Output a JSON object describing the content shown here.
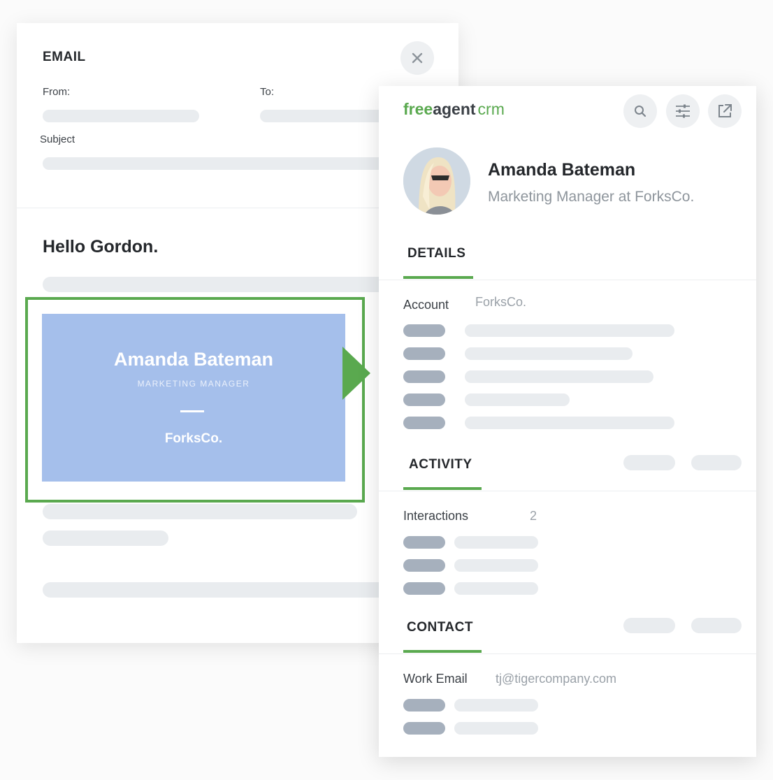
{
  "email": {
    "title": "EMAIL",
    "from_label": "From:",
    "to_label": "To:",
    "subject_label": "Subject",
    "greeting": "Hello Gordon."
  },
  "business_card": {
    "name": "Amanda Bateman",
    "role": "MARKETING MANAGER",
    "company": "ForksCo."
  },
  "crm": {
    "logo": {
      "free": "free",
      "agent": "agent",
      "crm": "crm"
    },
    "toolbar": {
      "icons": [
        "search-icon",
        "sliders-icon",
        "external-link-icon"
      ]
    },
    "contact": {
      "name": "Amanda Bateman",
      "title": "Marketing Manager at ForksCo."
    },
    "details": {
      "heading": "DETAILS",
      "account_label": "Account",
      "account_value": "ForksCo."
    },
    "activity": {
      "heading": "ACTIVITY",
      "interactions_label": "Interactions",
      "interactions_count": "2"
    },
    "contact_section": {
      "heading": "CONTACT",
      "work_email_label": "Work Email",
      "work_email_value": "tj@tigercompany.com"
    }
  },
  "colors": {
    "accent_green": "#5aa94f",
    "card_blue": "#a5bfeb",
    "placeholder": "#e9ecef",
    "placeholder_dark": "#a6b0bd"
  }
}
